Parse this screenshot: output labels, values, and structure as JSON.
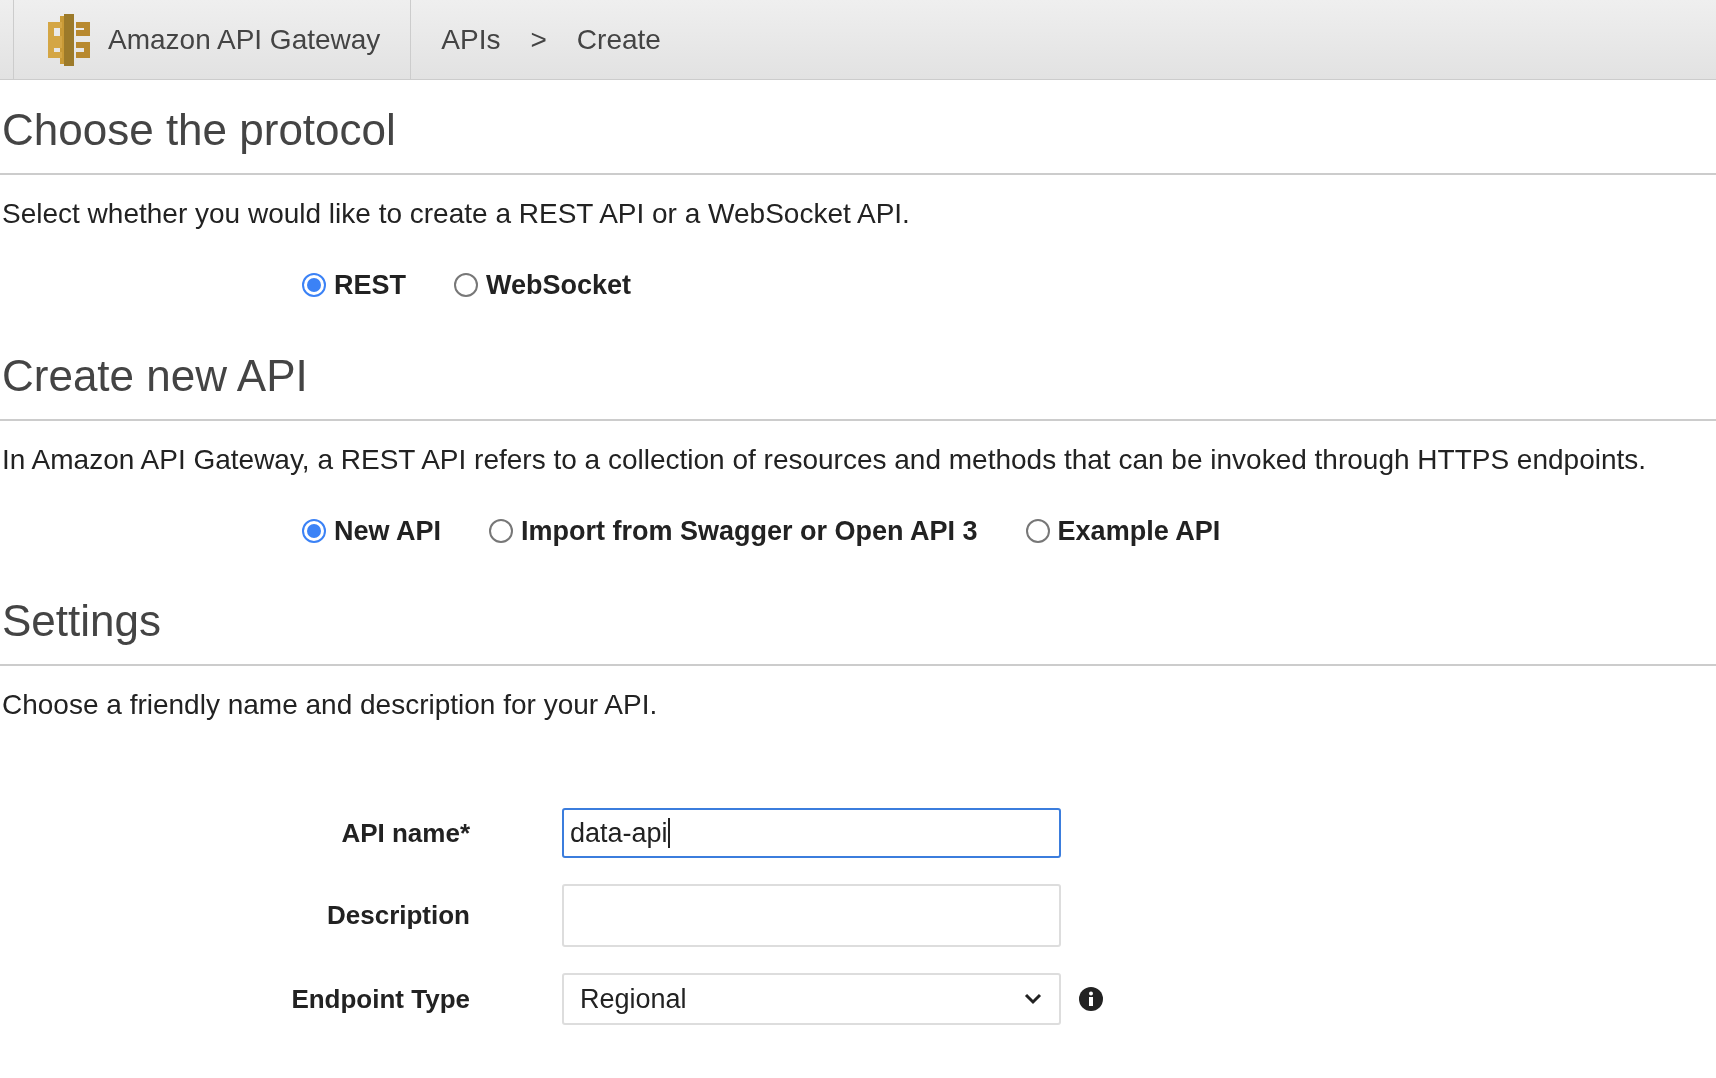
{
  "header": {
    "service": "Amazon API Gateway",
    "breadcrumbs": [
      "APIs",
      "Create"
    ],
    "separator": ">"
  },
  "sections": [
    {
      "title": "Choose the protocol",
      "description": "Select whether you would like to create a REST API or a WebSocket API.",
      "options": [
        {
          "label": "REST",
          "selected": true
        },
        {
          "label": "WebSocket",
          "selected": false
        }
      ]
    },
    {
      "title": "Create new API",
      "description": "In Amazon API Gateway, a REST API refers to a collection of resources and methods that can be invoked through HTTPS endpoints.",
      "options": [
        {
          "label": "New API",
          "selected": true
        },
        {
          "label": "Import from Swagger or Open API 3",
          "selected": false
        },
        {
          "label": "Example API",
          "selected": false
        }
      ]
    },
    {
      "title": "Settings",
      "description": "Choose a friendly name and description for your API."
    }
  ],
  "form": [
    {
      "kind": "text",
      "label": "API name*",
      "value": "data-api",
      "focused": true
    },
    {
      "kind": "text",
      "label": "Description",
      "focused": false
    },
    {
      "kind": "select",
      "label": "Endpoint Type",
      "value": "Regional",
      "focused": false
    }
  ]
}
